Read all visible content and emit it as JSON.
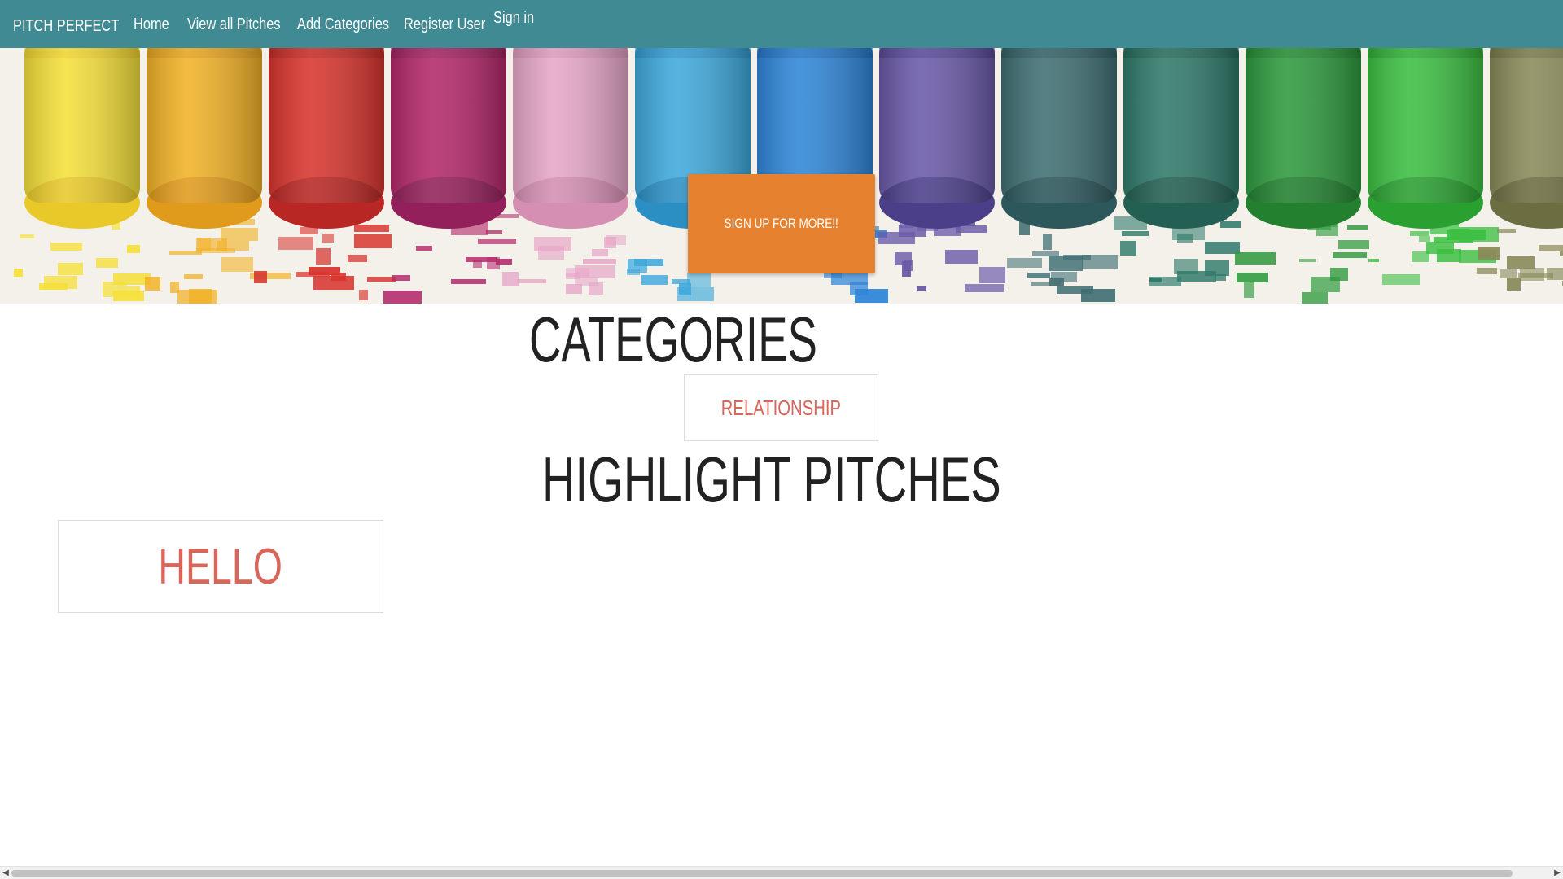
{
  "navbar": {
    "brand": "PITCH PERFECT",
    "items": [
      {
        "label": "Home"
      },
      {
        "label": "View all Pitches"
      },
      {
        "label": "Add Categories"
      },
      {
        "label": "Register User"
      },
      {
        "label": "Sign in"
      }
    ],
    "bg_color": "#3f8a93"
  },
  "hero": {
    "image": "colorful-chalk-pastels",
    "cta_label": "SIGN UP FOR MORE!!",
    "cta_color": "#e6812f"
  },
  "categories": {
    "title": "CATEGORIES",
    "items": [
      {
        "label": "RELATIONSHIP"
      }
    ]
  },
  "highlights": {
    "title": "HIGHLIGHT PITCHES",
    "items": [
      {
        "label": "HELLO"
      }
    ]
  },
  "accent_color": "#d9665a"
}
